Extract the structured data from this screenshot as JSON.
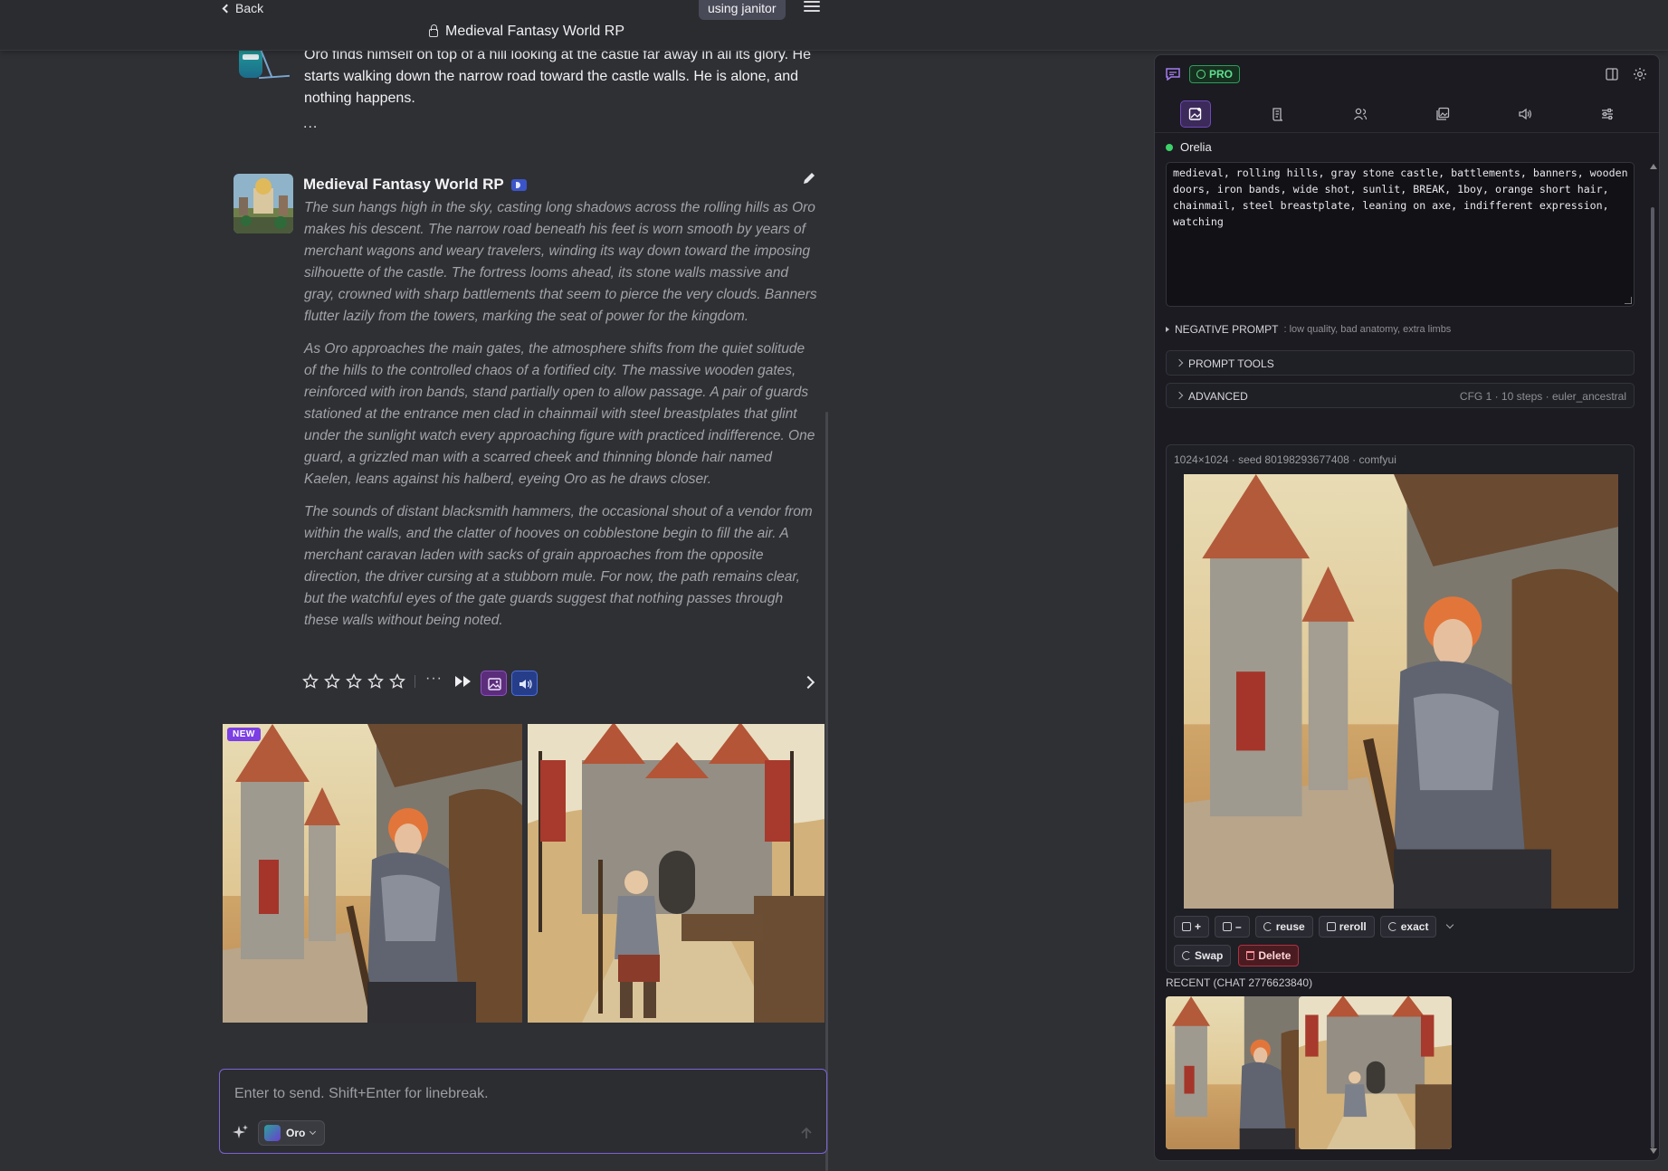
{
  "topbar": {
    "back_label": "Back",
    "title": "Medieval Fantasy World RP",
    "mode_pill": "using janitor"
  },
  "previous_message": {
    "text": "Oro finds himself on top of a hill looking at the castle far away in all its glory. He starts walking down the narrow road toward the castle walls. He is alone, and nothing happens.",
    "ellipsis": "..."
  },
  "message": {
    "bot_name": "Medieval Fantasy World RP",
    "paragraphs": [
      "The sun hangs high in the sky, casting long shadows across the rolling hills as Oro makes his descent. The narrow road beneath his feet is worn smooth by years of merchant wagons and weary travelers, winding its way down toward the imposing silhouette of the castle. The fortress looms ahead, its stone walls massive and gray, crowned with sharp battlements that seem to pierce the very clouds. Banners flutter lazily from the towers, marking the seat of power for the kingdom.",
      "As Oro approaches the main gates, the atmosphere shifts from the quiet solitude of the hills to the controlled chaos of a fortified city. The massive wooden gates, reinforced with iron bands, stand partially open to allow passage. A pair of guards stationed at the entrance men clad in chainmail with steel breastplates that glint under the sunlight watch every approaching figure with practiced indifference. One guard, a grizzled man with a scarred cheek and thinning blonde hair named Kaelen, leans against his halberd, eyeing Oro as he draws closer.",
      "The sounds of distant blacksmith hammers, the occasional shout of a vendor from within the walls, and the clatter of hooves on cobblestone begin to fill the air. A merchant caravan laden with sacks of grain approaches from the opposite direction, the driver cursing at a stubborn mule. For now, the path remains clear, but the watchful eyes of the gate guards suggest that nothing passes through these walls without being noted."
    ],
    "rating": {
      "value": 0,
      "max": 5
    },
    "more_label": "···",
    "new_badge": "NEW"
  },
  "composer": {
    "placeholder": "Enter to send. Shift+Enter for linebreak.",
    "persona_name": "Oro"
  },
  "panel": {
    "pro_label": "PRO",
    "tabs": [
      "image-gen",
      "scroll",
      "characters",
      "gallery",
      "audio",
      "sliders"
    ],
    "active_tab": 0,
    "character_name": "Orelia",
    "prompt_text": "medieval, rolling hills, gray stone castle, battlements, banners, wooden doors, iron bands, wide shot, sunlit, BREAK, 1boy, orange short hair, chainmail, steel breastplate, leaning on axe, indifferent expression, watching",
    "negative_label": "NEGATIVE PROMPT",
    "negative_value": ": low quality, bad anatomy, extra limbs",
    "prompt_tools_label": "PROMPT TOOLS",
    "advanced_label": "ADVANCED",
    "advanced_meta": "CFG 1 · 10 steps · euler_ancestral",
    "result_meta": "1024×1024 · seed 80198293677408 · comfyui",
    "buttons": {
      "copy_plus": "+",
      "copy_minus": "–",
      "reuse": "reuse",
      "reroll": "reroll",
      "exact": "exact",
      "swap": "Swap",
      "delete": "Delete"
    },
    "recent_label": "RECENT (CHAT 2776623840)"
  },
  "colors": {
    "accent_purple": "#7b63d6",
    "pro_green": "#5ee08f",
    "delete_red": "#b3303e"
  }
}
